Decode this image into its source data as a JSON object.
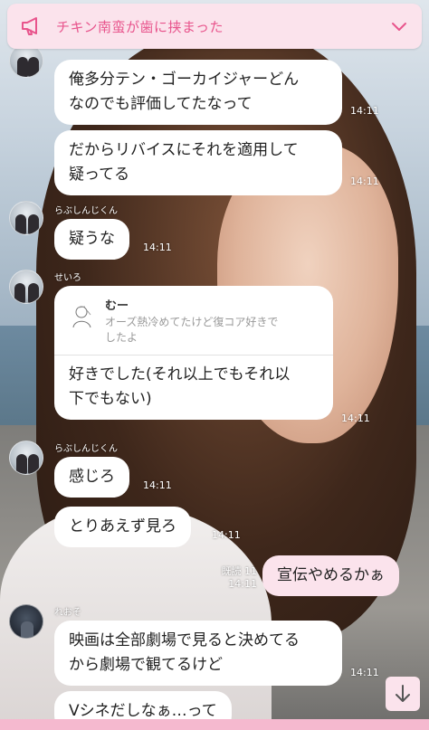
{
  "header": {
    "title": "チキン南蛮が歯に挟まった",
    "megaphone_icon": "megaphone-icon",
    "expand_icon": "chevron-down-icon",
    "accent_color": "#e8548c",
    "background_color": "#fbe3ec"
  },
  "messages": [
    {
      "sender": "",
      "lines": [
        "俺多分テン・ゴーカイジャーどん",
        "なのでも評価してたなって"
      ],
      "time": "14:11"
    },
    {
      "sender": "",
      "lines": [
        "だからリバイスにそれを適用して",
        "疑ってる"
      ],
      "time": "14:11"
    },
    {
      "sender": "らぶしんじくん",
      "lines": [
        "疑うな"
      ],
      "time": "14:11"
    },
    {
      "sender": "せいろ",
      "reply": {
        "name": "むー",
        "lines": [
          "オーズ熱冷めてたけど復コア好きで",
          "したよ"
        ]
      },
      "lines": [
        "好きでした(それ以上でもそれ以",
        "下でもない)"
      ],
      "time": "14:11"
    },
    {
      "sender": "らぶしんじくん",
      "lines": [
        "感じろ"
      ],
      "time": "14:11"
    },
    {
      "sender": "",
      "lines": [
        "とりあえず見ろ"
      ],
      "time": "14:11"
    },
    {
      "sender": "me",
      "lines": [
        "宣伝やめるかぁ"
      ],
      "read": "既読 11",
      "time": "14:11"
    },
    {
      "sender": "れおそ",
      "lines": [
        "映画は全部劇場で見ると決めてる",
        "から劇場で観てるけど"
      ],
      "time": "14:11"
    },
    {
      "sender": "",
      "lines": [
        "Vシネだしなぁ…って"
      ],
      "time": ""
    }
  ],
  "scroll_button": {
    "icon": "arrow-down-icon"
  },
  "colors": {
    "my_bubble": "#fbe3ec",
    "their_bubble": "#ffffff"
  }
}
